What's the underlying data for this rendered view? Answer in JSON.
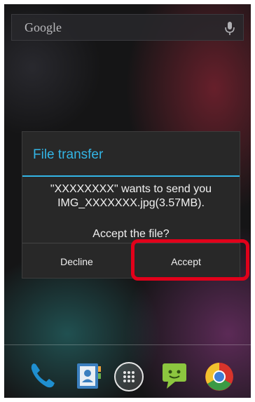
{
  "home": {
    "search_label": "Google",
    "search_icon": "google-wordmark",
    "mic_icon": "mic-icon"
  },
  "dialog": {
    "title": "File transfer",
    "message_line1": "\"XXXXXXXX\" wants to send you",
    "message_line2": "IMG_XXXXXXX.jpg(3.57MB).",
    "question": "Accept the file?",
    "decline_label": "Decline",
    "accept_label": "Accept",
    "accent_color": "#33b5e5",
    "highlight_color": "#e2001a"
  },
  "dock": {
    "apps": [
      "phone-icon",
      "contacts-icon",
      "app-drawer-icon",
      "messaging-icon",
      "chrome-icon"
    ]
  }
}
